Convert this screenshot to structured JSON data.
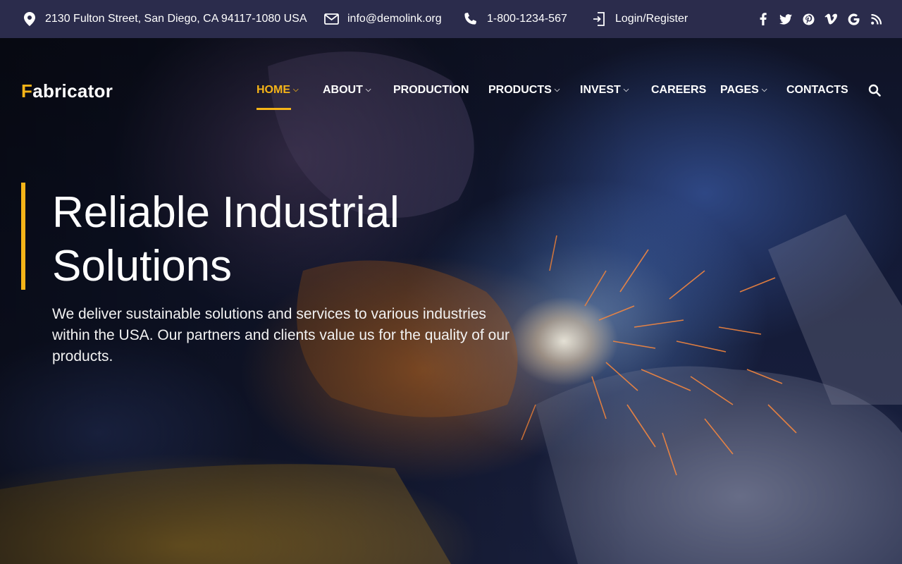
{
  "topbar": {
    "address": "2130 Fulton Street, San Diego, CA 94117-1080 USA",
    "email": "info@demolink.org",
    "phone": "1-800-1234-567",
    "login": "Login/Register",
    "social": [
      {
        "icon": "facebook-icon",
        "glyph": "f"
      },
      {
        "icon": "twitter-icon",
        "glyph": "t"
      },
      {
        "icon": "pinterest-icon",
        "glyph": "p"
      },
      {
        "icon": "vimeo-icon",
        "glyph": "v"
      },
      {
        "icon": "google-icon",
        "glyph": "G"
      },
      {
        "icon": "rss-icon",
        "glyph": "rss"
      }
    ]
  },
  "brand": {
    "logo_first": "F",
    "logo_rest": "abricator"
  },
  "nav": {
    "items": [
      {
        "label": "HOME",
        "has_dropdown": true,
        "active": true
      },
      {
        "label": "ABOUT",
        "has_dropdown": true,
        "active": false
      },
      {
        "label": "PRODUCTION",
        "has_dropdown": false,
        "active": false
      },
      {
        "label": "PRODUCTS",
        "has_dropdown": true,
        "active": false
      },
      {
        "label": "INVEST",
        "has_dropdown": true,
        "active": false
      },
      {
        "label": "CAREERS",
        "has_dropdown": false,
        "active": false
      },
      {
        "label": "PAGES",
        "has_dropdown": true,
        "active": false
      },
      {
        "label": "CONTACTS",
        "has_dropdown": false,
        "active": false
      }
    ],
    "search_icon": "search-icon"
  },
  "hero": {
    "title": "Reliable Industrial Solutions",
    "subtitle": "We deliver sustainable solutions and services to various industries within the USA. Our partners and clients value us for the quality of our products."
  },
  "colors": {
    "accent": "#f5b418",
    "topbar_bg": "#2b2c4c",
    "text": "#ffffff"
  }
}
